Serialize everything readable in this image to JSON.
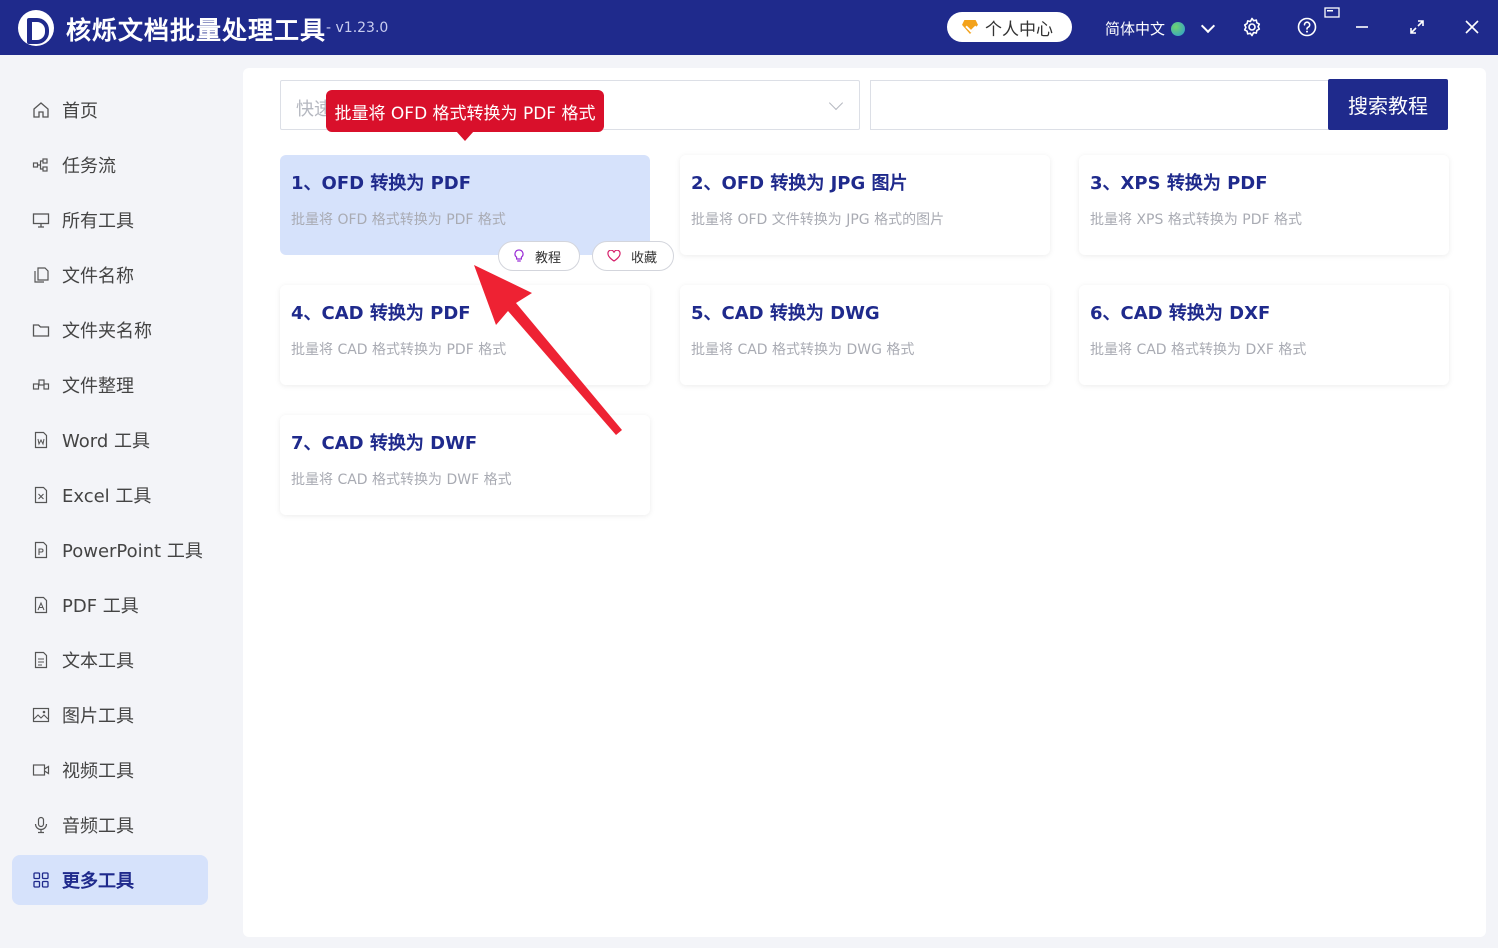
{
  "titlebar": {
    "app_title": "核烁文档批量处理工具",
    "version": "- v1.23.0",
    "user_center": "个人中心",
    "language": "简体中文"
  },
  "sidebar": {
    "items": [
      {
        "label": "首页",
        "icon": "home-icon"
      },
      {
        "label": "任务流",
        "icon": "workflow-icon"
      },
      {
        "label": "所有工具",
        "icon": "monitor-icon"
      },
      {
        "label": "文件名称",
        "icon": "file-copy-icon"
      },
      {
        "label": "文件夹名称",
        "icon": "folder-icon"
      },
      {
        "label": "文件整理",
        "icon": "organize-icon"
      },
      {
        "label": "Word 工具",
        "icon": "word-file-icon"
      },
      {
        "label": "Excel 工具",
        "icon": "excel-file-icon"
      },
      {
        "label": "PowerPoint 工具",
        "icon": "ppt-file-icon"
      },
      {
        "label": "PDF 工具",
        "icon": "pdf-file-icon"
      },
      {
        "label": "文本工具",
        "icon": "text-file-icon"
      },
      {
        "label": "图片工具",
        "icon": "image-icon"
      },
      {
        "label": "视频工具",
        "icon": "video-icon"
      },
      {
        "label": "音频工具",
        "icon": "microphone-icon"
      },
      {
        "label": "更多工具",
        "icon": "grid-icon",
        "active": true
      }
    ]
  },
  "toolbar": {
    "quick_select_placeholder": "快速",
    "search_placeholder": "",
    "search_button": "搜索教程"
  },
  "tooltip": "批量将 OFD 格式转换为 PDF 格式",
  "cards": [
    {
      "title": "1、OFD 转换为 PDF",
      "desc": "批量将 OFD 格式转换为 PDF 格式"
    },
    {
      "title": "2、OFD 转换为 JPG 图片",
      "desc": "批量将 OFD 文件转换为 JPG 格式的图片"
    },
    {
      "title": "3、XPS 转换为 PDF",
      "desc": "批量将 XPS 格式转换为 PDF 格式"
    },
    {
      "title": "4、CAD 转换为 PDF",
      "desc": "批量将 CAD 格式转换为 PDF 格式"
    },
    {
      "title": "5、CAD 转换为 DWG",
      "desc": "批量将 CAD 格式转换为 DWG 格式"
    },
    {
      "title": "6、CAD 转换为 DXF",
      "desc": "批量将 CAD 格式转换为 DXF 格式"
    },
    {
      "title": "7、CAD 转换为 DWF",
      "desc": "批量将 CAD 格式转换为 DWF 格式"
    }
  ],
  "card_actions": {
    "tutorial": "教程",
    "favorite": "收藏"
  },
  "colors": {
    "brand": "#1f2a8c",
    "active_bg": "#d6e2fb",
    "tooltip": "#d9102b",
    "annotation_arrow": "#ee2233"
  }
}
